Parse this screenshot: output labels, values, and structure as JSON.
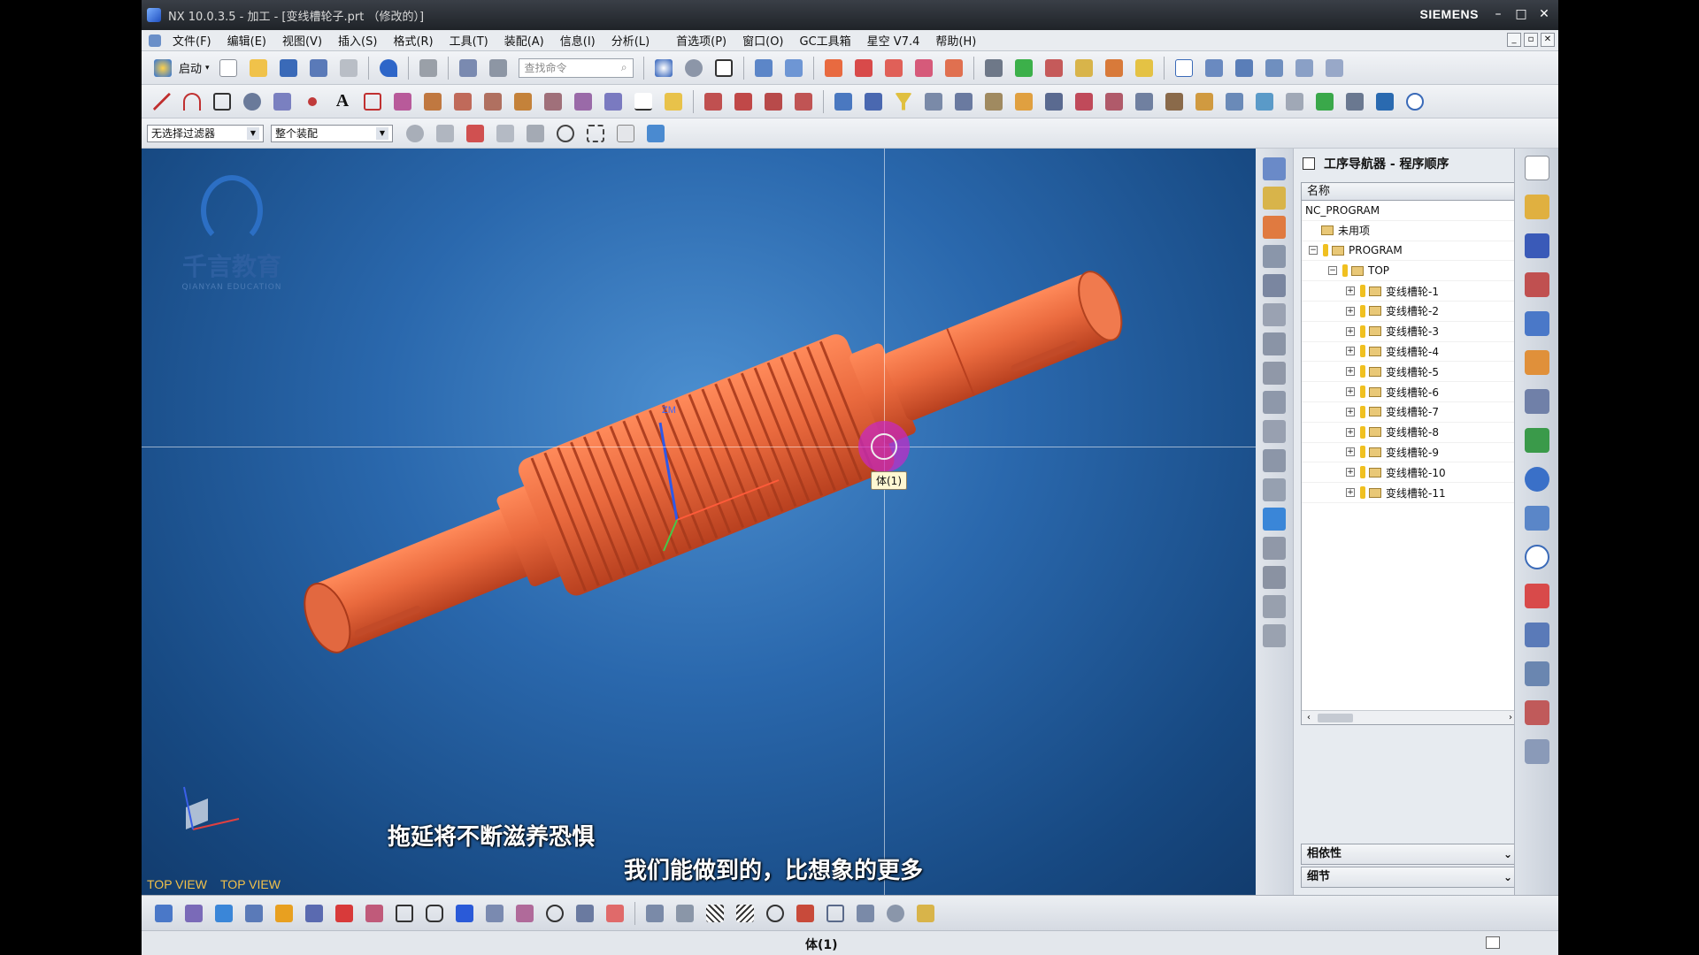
{
  "window": {
    "title": "NX 10.0.3.5 - 加工 - [变线槽轮子.prt （修改的）]",
    "brand": "SIEMENS",
    "controls": [
      "–",
      "□",
      "✕"
    ]
  },
  "menu": {
    "items": [
      "文件(F)",
      "编辑(E)",
      "视图(V)",
      "插入(S)",
      "格式(R)",
      "工具(T)",
      "装配(A)",
      "信息(I)",
      "分析(L)",
      "首选项(P)",
      "窗口(O)",
      "GC工具箱",
      "星空 V7.4",
      "帮助(H)"
    ]
  },
  "toolbar": {
    "start_label": "启动",
    "search_placeholder": "查找命令",
    "filter_value": "无选择过滤器",
    "scope_value": "整个装配"
  },
  "viewport": {
    "logo_text": "千言教育",
    "logo_sub": "QIANYAN EDUCATION",
    "view_label_1": "TOP VIEW",
    "view_label_2": "TOP VIEW",
    "subtitle_1": "拖延将不断滋养恐惧",
    "subtitle_2": "我们能做到的，比想象的更多",
    "tooltip": "体(1)",
    "triad_zm": "ZM",
    "part_color": "#e8603c",
    "bg_color": "#2a68ad"
  },
  "navigator": {
    "title": "工序导航器 - 程序顺序",
    "column_name": "名称",
    "root": "NC_PROGRAM",
    "unused": "未用项",
    "program": "PROGRAM",
    "top": "TOP",
    "ops": [
      "变线槽轮-1",
      "变线槽轮-2",
      "变线槽轮-3",
      "变线槽轮-4",
      "变线槽轮-5",
      "变线槽轮-6",
      "变线槽轮-7",
      "变线槽轮-8",
      "变线槽轮-9",
      "变线槽轮-10",
      "变线槽轮-11"
    ],
    "section_dependencies": "相依性",
    "section_details": "细节"
  },
  "status": {
    "text": "体(1)"
  }
}
